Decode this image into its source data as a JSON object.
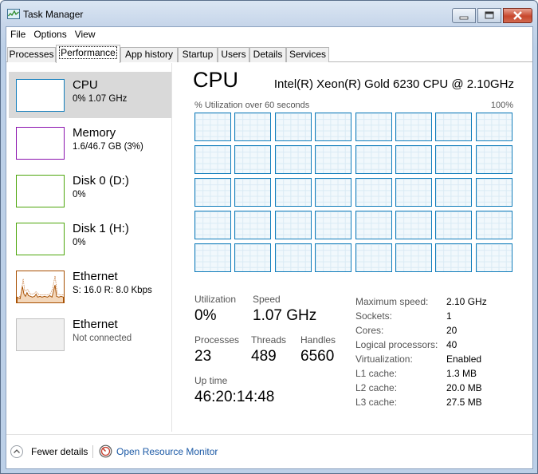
{
  "window": {
    "title": "Task Manager"
  },
  "menu": [
    {
      "label": "File"
    },
    {
      "label": "Options"
    },
    {
      "label": "View"
    }
  ],
  "tabs": [
    {
      "label": "Processes",
      "active": false
    },
    {
      "label": "Performance",
      "active": true
    },
    {
      "label": "App history",
      "active": false
    },
    {
      "label": "Startup",
      "active": false
    },
    {
      "label": "Users",
      "active": false
    },
    {
      "label": "Details",
      "active": false
    },
    {
      "label": "Services",
      "active": false
    }
  ],
  "sidebar": [
    {
      "title": "CPU",
      "subtitle": "0% 1.07 GHz",
      "color": "#117dbb",
      "selected": true,
      "graph": "cpu"
    },
    {
      "title": "Memory",
      "subtitle": "1.6/46.7 GB (3%)",
      "color": "#8b12ae",
      "selected": false,
      "graph": "memory"
    },
    {
      "title": "Disk 0 (D:)",
      "subtitle": "0%",
      "color": "#4da60c",
      "selected": false,
      "graph": "disk"
    },
    {
      "title": "Disk 1 (H:)",
      "subtitle": "0%",
      "color": "#4da60c",
      "selected": false,
      "graph": "disk"
    },
    {
      "title": "Ethernet",
      "subtitle": "S: 16.0  R: 8.0 Kbps",
      "color": "#a74f01",
      "selected": false,
      "graph": "ethernet"
    },
    {
      "title": "Ethernet",
      "subtitle": "Not connected",
      "color": "#c0c0c0",
      "selected": false,
      "graph": "inactive"
    }
  ],
  "cpu": {
    "heading": "CPU",
    "model": "Intel(R) Xeon(R) Gold 6230 CPU @ 2.10GHz",
    "graph_caption": "% Utilization over 60 seconds",
    "graph_max": "100%",
    "graph_rows": 5,
    "graph_cols": 8,
    "graph_color": "#117dbb",
    "stats": {
      "utilization": {
        "label": "Utilization",
        "value": "0%"
      },
      "speed": {
        "label": "Speed",
        "value": "1.07 GHz"
      },
      "processes": {
        "label": "Processes",
        "value": "23"
      },
      "threads": {
        "label": "Threads",
        "value": "489"
      },
      "handles": {
        "label": "Handles",
        "value": "6560"
      },
      "uptime": {
        "label": "Up time",
        "value": "46:20:14:48"
      }
    },
    "details": [
      {
        "label": "Maximum speed:",
        "value": "2.10 GHz"
      },
      {
        "label": "Sockets:",
        "value": "1"
      },
      {
        "label": "Cores:",
        "value": "20"
      },
      {
        "label": "Logical processors:",
        "value": "40"
      },
      {
        "label": "Virtualization:",
        "value": "Enabled"
      },
      {
        "label": "L1 cache:",
        "value": "1.3 MB"
      },
      {
        "label": "L2 cache:",
        "value": "20.0 MB"
      },
      {
        "label": "L3 cache:",
        "value": "27.5 MB"
      }
    ]
  },
  "footer": {
    "fewer_details": "Fewer details",
    "open_monitor": "Open Resource Monitor"
  }
}
